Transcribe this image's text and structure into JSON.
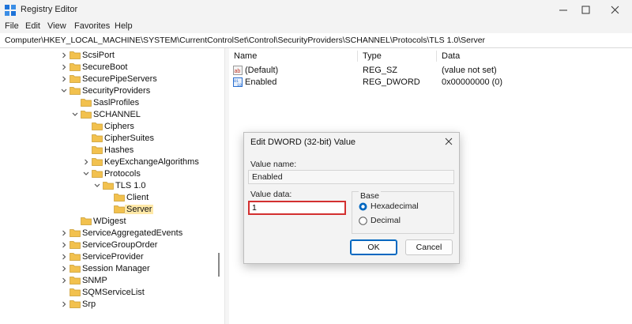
{
  "app": {
    "title": "Registry Editor"
  },
  "menu": [
    "File",
    "Edit",
    "View",
    "Favorites",
    "Help"
  ],
  "address": "Computer\\HKEY_LOCAL_MACHINE\\SYSTEM\\CurrentControlSet\\Control\\SecurityProviders\\SCHANNEL\\Protocols\\TLS 1.0\\Server",
  "tree": [
    {
      "label": "ScsiPort",
      "depth": 0,
      "exp": "right"
    },
    {
      "label": "SecureBoot",
      "depth": 0,
      "exp": "right"
    },
    {
      "label": "SecurePipeServers",
      "depth": 0,
      "exp": "right"
    },
    {
      "label": "SecurityProviders",
      "depth": 0,
      "exp": "down"
    },
    {
      "label": "SaslProfiles",
      "depth": 1,
      "exp": ""
    },
    {
      "label": "SCHANNEL",
      "depth": 1,
      "exp": "down"
    },
    {
      "label": "Ciphers",
      "depth": 2,
      "exp": ""
    },
    {
      "label": "CipherSuites",
      "depth": 2,
      "exp": ""
    },
    {
      "label": "Hashes",
      "depth": 2,
      "exp": ""
    },
    {
      "label": "KeyExchangeAlgorithms",
      "depth": 2,
      "exp": "right"
    },
    {
      "label": "Protocols",
      "depth": 2,
      "exp": "down"
    },
    {
      "label": "TLS 1.0",
      "depth": 3,
      "exp": "down"
    },
    {
      "label": "Client",
      "depth": 4,
      "exp": ""
    },
    {
      "label": "Server",
      "depth": 4,
      "exp": "",
      "selected": true
    },
    {
      "label": "WDigest",
      "depth": 1,
      "exp": ""
    },
    {
      "label": "ServiceAggregatedEvents",
      "depth": 0,
      "exp": "right"
    },
    {
      "label": "ServiceGroupOrder",
      "depth": 0,
      "exp": "right"
    },
    {
      "label": "ServiceProvider",
      "depth": 0,
      "exp": "right"
    },
    {
      "label": "Session Manager",
      "depth": 0,
      "exp": "right"
    },
    {
      "label": "SNMP",
      "depth": 0,
      "exp": "right"
    },
    {
      "label": "SQMServiceList",
      "depth": 0,
      "exp": ""
    },
    {
      "label": "Srp",
      "depth": 0,
      "exp": "right"
    }
  ],
  "columns": {
    "name": "Name",
    "type": "Type",
    "data": "Data"
  },
  "values": [
    {
      "name": "(Default)",
      "type": "REG_SZ",
      "data": "(value not set)",
      "icon": "string-value-icon"
    },
    {
      "name": "Enabled",
      "type": "REG_DWORD",
      "data": "0x00000000 (0)",
      "icon": "binary-value-icon"
    }
  ],
  "dialog": {
    "title": "Edit DWORD (32-bit) Value",
    "value_name_label": "Value name:",
    "value_name": "Enabled",
    "value_data_label": "Value data:",
    "value_data": "1",
    "base_label": "Base",
    "hex_label": "Hexadecimal",
    "dec_label": "Decimal",
    "base_selected": "Hexadecimal",
    "ok_label": "OK",
    "cancel_label": "Cancel"
  },
  "colors": {
    "folder": "#f2c14e",
    "selected": "#ffe9a8",
    "accent": "#0067c0",
    "highlight": "#d32f2f"
  }
}
